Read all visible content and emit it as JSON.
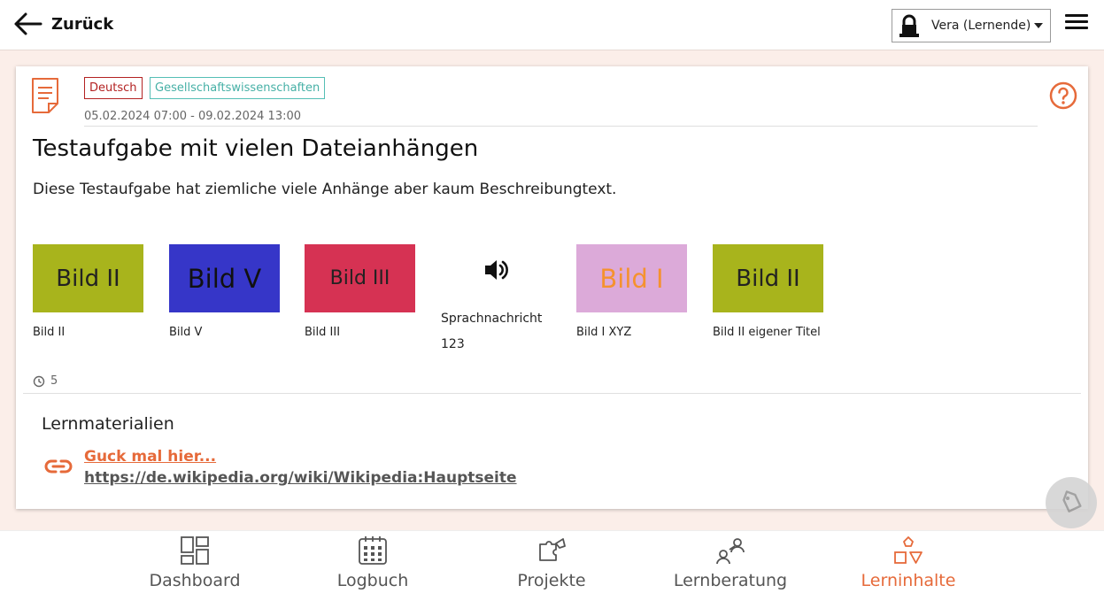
{
  "header": {
    "back_label": "Zurück",
    "user_name": "Vera (Lernende)"
  },
  "task": {
    "tags": [
      "Deutsch",
      "Gesellschaftswissenschaften"
    ],
    "date_range": "05.02.2024 07:00 - 09.02.2024 13:00",
    "title": "Testaufgabe mit vielen Dateianhängen",
    "description": "Diese Testaufgabe hat ziemliche viele Anhänge aber kaum Beschreibungtext.",
    "attachments": [
      {
        "thumb_text": "Bild II",
        "label": "Bild II",
        "bg": "#a8b41c",
        "fg": "#222222"
      },
      {
        "thumb_text": "Bild V",
        "label": "Bild V",
        "bg": "#3636c8",
        "fg": "#111111"
      },
      {
        "thumb_text": "Bild III",
        "label": "Bild III",
        "bg": "#d63253",
        "fg": "#222222"
      },
      {
        "label_line1": "Sprachnachricht",
        "label_line2": "123",
        "icon": "speaker-icon"
      },
      {
        "thumb_text": "Bild I",
        "label": "Bild I XYZ",
        "bg": "#dcaad9",
        "fg": "#f5922f"
      },
      {
        "thumb_text": "Bild II",
        "label": "Bild II eigener Titel",
        "bg": "#a8b41c",
        "fg": "#222222"
      }
    ],
    "count": "5"
  },
  "materials": {
    "heading": "Lernmaterialien",
    "link_title": "Guck mal hier...",
    "link_url": "https://de.wikipedia.org/wiki/Wikipedia:Hauptseite"
  },
  "nav": {
    "items": [
      {
        "label": "Dashboard",
        "icon": "dashboard-icon"
      },
      {
        "label": "Logbuch",
        "icon": "calendar-icon"
      },
      {
        "label": "Projekte",
        "icon": "puzzle-icon"
      },
      {
        "label": "Lernberatung",
        "icon": "counseling-icon"
      },
      {
        "label": "Lerninhalte",
        "icon": "shapes-icon"
      }
    ],
    "active_color": "#e66a3a"
  },
  "colors": {
    "accent": "#e66a3a",
    "tag_deutsch": "#b32222",
    "tag_gesellschaft": "#55bfb5"
  }
}
